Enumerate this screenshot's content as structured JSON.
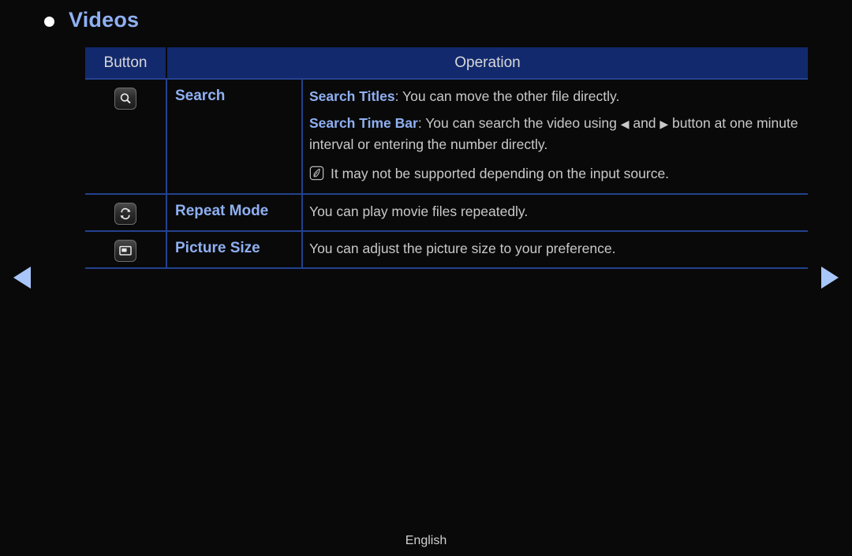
{
  "page": {
    "title": "Videos",
    "bullet_icon": "bullet-dot-icon",
    "background_color": "#090909",
    "accent_color": "#8fb0f2",
    "header_bg_color": "#12296d",
    "border_color": "#23418f",
    "body_text_color": "#c9c9c9"
  },
  "table": {
    "columns": [
      {
        "key": "button",
        "label": "Button"
      },
      {
        "key": "operation",
        "label": "Operation"
      }
    ],
    "rows": [
      {
        "icon": "search-magnifier-icon",
        "label": "Search",
        "lines": [
          {
            "key": "Search Titles",
            "sep": ": ",
            "text": "You can move the other file directly."
          },
          {
            "key": "Search Time Bar",
            "sep": ": ",
            "text_before": "You can search the video using ",
            "left_arrow": "◀",
            "text_middle": " and ",
            "right_arrow": "▶",
            "text_after": " button at one minute interval or entering the number directly."
          }
        ],
        "note": {
          "icon": "note-pencil-icon",
          "text": "It may not be supported depending on the input source."
        }
      },
      {
        "icon": "repeat-loop-icon",
        "label": "Repeat Mode",
        "lines": [
          {
            "text": "You can play movie files repeatedly."
          }
        ]
      },
      {
        "icon": "picture-size-screen-icon",
        "label": "Picture Size",
        "lines": [
          {
            "text": "You can adjust the picture size to your preference."
          }
        ]
      }
    ]
  },
  "navigation": {
    "prev_icon": "arrow-left-icon",
    "next_icon": "arrow-right-icon",
    "arrow_color": "#a8c6fa"
  },
  "footer": {
    "language": "English"
  }
}
